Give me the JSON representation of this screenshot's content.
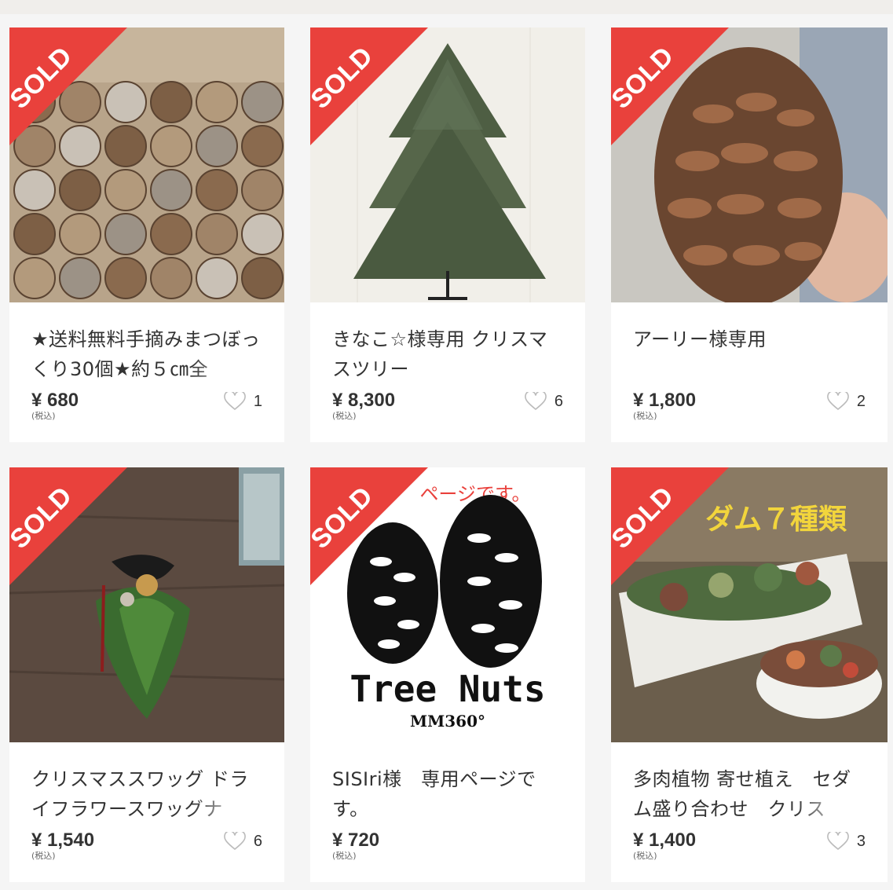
{
  "colors": {
    "sold_red": "#e9413c",
    "background": "#f5f5f5"
  },
  "sold_label": "SOLD",
  "tax_label": "(税込)",
  "items": [
    {
      "title": "★送料無料手摘みまつぼっくり30個★約５㎝全",
      "price": "¥ 680",
      "likes": "1",
      "image": "pinecones-grid-photo"
    },
    {
      "title": "きなこ☆様専用 クリスマスツリー",
      "price": "¥ 8,300",
      "likes": "6",
      "image": "christmas-tree-photo"
    },
    {
      "title": "アーリー様専用",
      "price": "¥ 1,800",
      "likes": "2",
      "image": "giant-pinecone-photo"
    },
    {
      "title": "クリスマススワッグ ドライフラワースワッグナ",
      "price": "¥ 1,540",
      "likes": "6",
      "image": "swag-wreath-photo"
    },
    {
      "title": "SISIri様　専用ページです。",
      "price": "¥ 720",
      "likes": "",
      "image": "tree-nuts-logo",
      "image_text": {
        "brand": "Tree Nuts",
        "sub": "MM360°",
        "banner": "ページです。"
      }
    },
    {
      "title": "多肉植物 寄せ植え　セダム盛り合わせ　クリス",
      "price": "¥ 1,400",
      "likes": "3",
      "image": "succulents-photo",
      "image_text": {
        "banner": "ダム７種類"
      }
    }
  ]
}
